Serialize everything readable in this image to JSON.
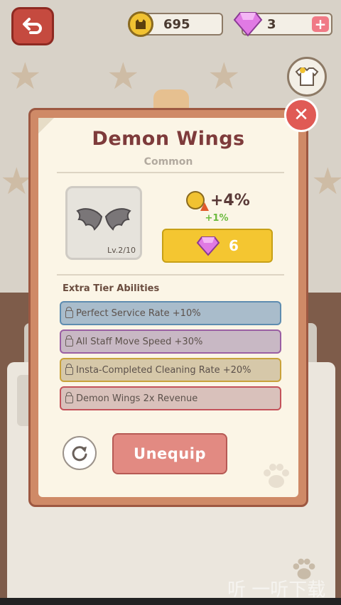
{
  "hud": {
    "coins": "695",
    "gems": "3",
    "plus_symbol": "+"
  },
  "popup": {
    "title": "Demon Wings",
    "rarity": "Common",
    "item_level": "Lv.2/10",
    "bonus": "+4%",
    "next_bonus": "+1%",
    "upgrade_cost": "6",
    "section_title": "Extra Tier Abilities",
    "abilities": [
      {
        "text": "Perfect Service Rate +10%",
        "bg": "#a9bccb",
        "border": "#5e8cb0"
      },
      {
        "text": "All Staff Move Speed +30%",
        "bg": "#c8b8c4",
        "border": "#9a5fa3"
      },
      {
        "text": "Insta-Completed Cleaning Rate +20%",
        "bg": "#d6c8a9",
        "border": "#c9a23a"
      },
      {
        "text": "Demon Wings 2x Revenue",
        "bg": "#d9c1bb",
        "border": "#c4525a"
      }
    ],
    "unequip_label": "Unequip",
    "close_symbol": "✕"
  },
  "icons": {
    "back": "back-arrow-icon",
    "coin": "cat-coin-icon",
    "gem": "pink-gem-icon",
    "outfit": "outfit-shop-icon",
    "reset": "refresh-icon",
    "paw": "paw-icon"
  },
  "colors": {
    "frame": "#cf8a67",
    "paper": "#fbf5e6",
    "title": "#7e3b3b",
    "upgrade": "#f4c631",
    "unequip": "#e28a82",
    "close": "#e05a55"
  },
  "watermark": "听 一听下载"
}
